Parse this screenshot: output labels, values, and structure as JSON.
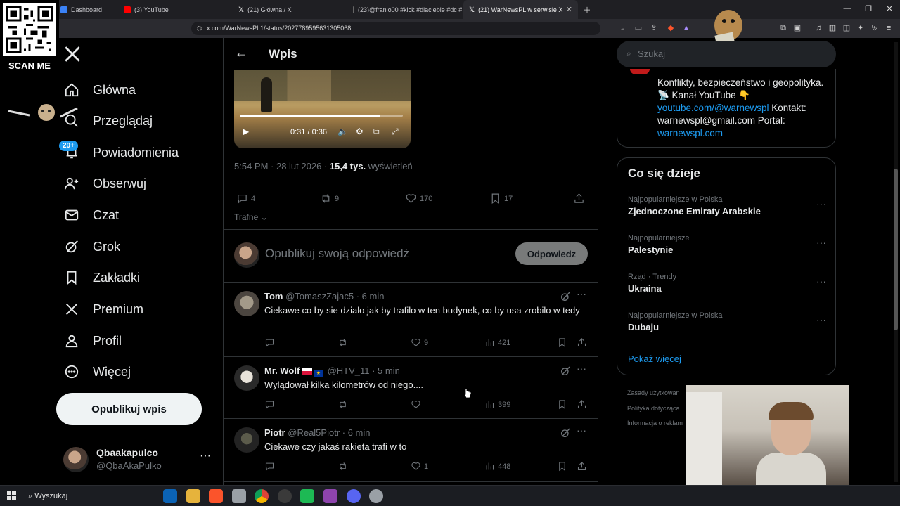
{
  "browser": {
    "tabs": [
      {
        "label": "Dashboard",
        "color": "#3b82f6"
      },
      {
        "label": "(3) YouTube",
        "color": "#ff0000"
      },
      {
        "label": "(21) Główna / X",
        "color": "#ffffff"
      },
      {
        "label": "(23)@franio00 #kick #dlaciebie #dc #",
        "color": "#111111"
      },
      {
        "label": "(21) WarNewsPL w serwisie X",
        "color": "#ffffff"
      }
    ],
    "url": "x.com/WarNewsPL1/status/2027789595631305068"
  },
  "overlay": {
    "scan_label": "SCAN ME"
  },
  "nav": {
    "items": [
      {
        "label": "Główna",
        "icon": "home-icon"
      },
      {
        "label": "Przeglądaj",
        "icon": "search-icon"
      },
      {
        "label": "Powiadomienia",
        "icon": "bell-icon"
      },
      {
        "label": "Obserwuj",
        "icon": "follow-icon"
      },
      {
        "label": "Czat",
        "icon": "mail-icon"
      },
      {
        "label": "Grok",
        "icon": "grok-icon"
      },
      {
        "label": "Zakładki",
        "icon": "bookmark-icon"
      },
      {
        "label": "Premium",
        "icon": "x-logo-icon"
      },
      {
        "label": "Profil",
        "icon": "profile-icon"
      },
      {
        "label": "Więcej",
        "icon": "more-circle-icon"
      }
    ],
    "notif_badge": "20+",
    "post_button": "Opublikuj wpis",
    "user": {
      "name": "Qbaakapulco",
      "handle": "@QbaAkaPulko"
    }
  },
  "post": {
    "header_title": "Wpis",
    "video": {
      "time": "0:31 / 0:36",
      "progress": 0.86
    },
    "meta": {
      "time": "5:54 PM · 28 lut 2026 · ",
      "views_count": "15,4 tys.",
      "views_label": " wyświetleń"
    },
    "stats": {
      "replies": "4",
      "reposts": "9",
      "likes": "170",
      "bookmarks": "17"
    },
    "sort_label": "Trafne",
    "reply_placeholder": "Opublikuj swoją odpowiedź",
    "reply_button": "Odpowiedz"
  },
  "replies": [
    {
      "name": "Tom",
      "handle": "@TomaszZajac5 · 6 min",
      "text": "Ciekawe co by sie dzialo jak by trafilo w ten budynek, co by usa zrobilo w tedy",
      "likes": "9",
      "views": "421"
    },
    {
      "name": "Mr. Wolf",
      "handle": "@HTV_11 · 5 min",
      "text": "Wylądował kilka kilometrów od niego....",
      "likes": "",
      "views": "399"
    },
    {
      "name": "Piotr",
      "handle": "@Real5Piotr · 6 min",
      "text": "Ciekawe czy jakaś rakieta trafi w to",
      "likes": "1",
      "views": "448"
    }
  ],
  "right": {
    "search_placeholder": "Szukaj",
    "bio": {
      "line1": "Konflikty, bezpieczeństwo i geopolityka. 📡 Kanał YouTube 👇",
      "link1": "youtube.com/@warnewspl",
      "line2": " Kontakt: warnewspl@gmail.com Portal: ",
      "link2": "warnewspl.com"
    },
    "trends_title": "Co się dzieje",
    "trends": [
      {
        "context": "Najpopularniejsze w Polska",
        "title": "Zjednoczone Emiraty Arabskie"
      },
      {
        "context": "Najpopularniejsze",
        "title": "Palestynie"
      },
      {
        "context": "Rząd · Trendy",
        "title": "Ukraina"
      },
      {
        "context": "Najpopularniejsze w Polska",
        "title": "Dubaju"
      }
    ],
    "show_more": "Pokaż więcej",
    "footer": [
      "Zasady użytkowan",
      "Polityka dotycząca",
      "Informacja o reklam"
    ]
  },
  "taskbar": {
    "search": "Wyszukaj"
  }
}
